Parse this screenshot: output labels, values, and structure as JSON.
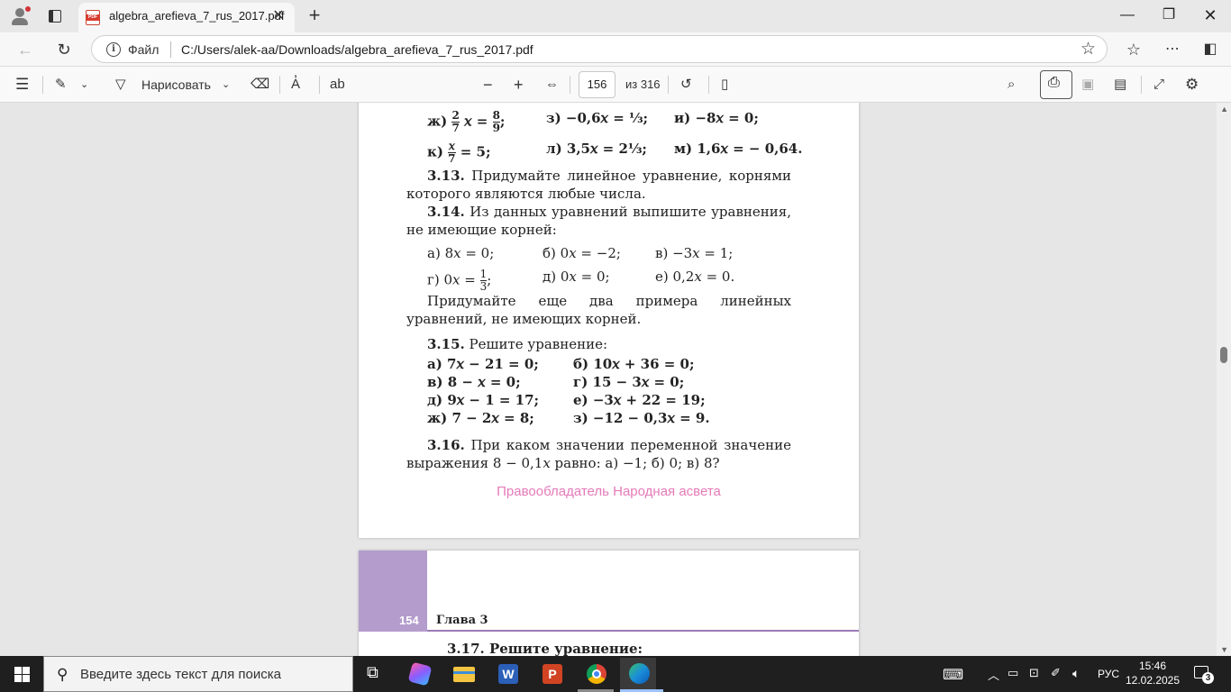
{
  "tab": {
    "title": "algebra_arefieva_7_rus_2017.pdf",
    "pdf_badge": "PDF"
  },
  "address": {
    "label": "Файл",
    "url": "C:/Users/alek-aa/Downloads/algebra_arefieva_7_rus_2017.pdf"
  },
  "toolbar": {
    "draw_label": "Нарисовать",
    "page_current": "156",
    "page_total": "из 316"
  },
  "page1": {
    "row_zh": {
      "a": "ж)",
      "b": "з) −0,6𝑥 = ⅓;",
      "c": "и)  −8𝑥 = 0;"
    },
    "row_k": {
      "b": "л) 3,5𝑥 = 2⅓;",
      "c": "м) 1,6𝑥 = − 0,64."
    },
    "p313_num": "3.13.",
    "p313_text": "Придумайте линейное уравнение, корнями которого являются любые числа.",
    "p314_num": "3.14.",
    "p314_text": "Из данных уравнений выпишите уравнения, не имеющие корней:",
    "p314_items": [
      "а) 8𝑥 = 0;",
      "б) 0𝑥 = −2;",
      "в) −3𝑥 = 1;",
      "г)",
      "д) 0𝑥 = 0;",
      "е) 0,2𝑥 = 0."
    ],
    "p314_extra": "Придумайте еще два примера линейных уравнений, не имеющих корней.",
    "p315_num": "3.15.",
    "p315_text": "Решите уравнение:",
    "p315_items": [
      "а)  7𝑥 − 21 = 0;",
      "б)  10𝑥 + 36 = 0;",
      "в)  8 − 𝑥 = 0;",
      "г)  15 − 3𝑥 = 0;",
      "д)  9𝑥 − 1 = 17;",
      "е)  −3𝑥 + 22 = 19;",
      "ж)  7 − 2𝑥 = 8;",
      "з)  −12 − 0,3𝑥 = 9."
    ],
    "p316_num": "3.16.",
    "p316_text": "При каком значении переменной значение выражения 8 − 0,1𝑥 равно: а) −1; б) 0; в) 8?",
    "watermark": "Правообладатель Народная асвета"
  },
  "page2": {
    "page_number": "154",
    "chapter": "Глава 3",
    "next_line": "3.17. Решите уравнение:"
  },
  "taskbar": {
    "search_placeholder": "Введите здесь текст для поиска",
    "lang": "РУС",
    "time": "15:46",
    "date": "12.02.2025",
    "notifications": "3"
  },
  "colors": {
    "watermark": "#e57ab8",
    "chapter_band": "#b49ccc",
    "taskbar": "#1f1f1f"
  }
}
